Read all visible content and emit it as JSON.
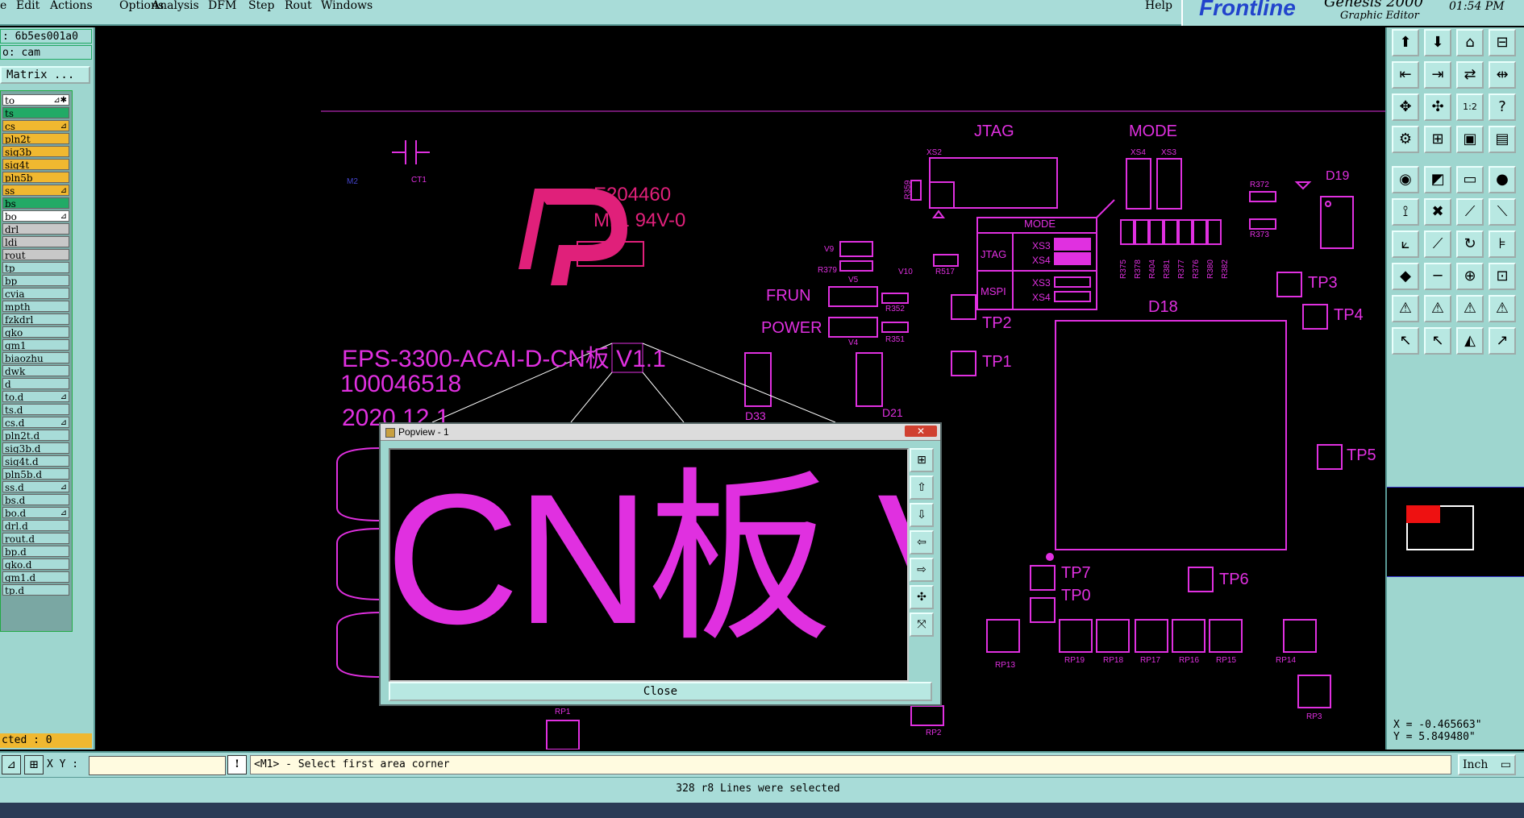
{
  "menu": [
    "Edit",
    "Actions",
    "Options",
    "Analysis",
    "DFM",
    "Step",
    "Rout",
    "Windows"
  ],
  "menu_first_partial": "e",
  "help": "Help",
  "brand": {
    "logo": "Frontline",
    "product": "Genesis 2000",
    "subtitle": "Graphic Editor",
    "time": "01:54 PM"
  },
  "left": {
    "job_field": ": 6b5es001a0",
    "step_field": "o: cam",
    "matrix_button": "Matrix ...",
    "layers": [
      {
        "name": "to",
        "color": "#ffffff",
        "mark": "⊿✱"
      },
      {
        "name": "ts",
        "color": "#22aa66",
        "mark": ""
      },
      {
        "name": "cs",
        "color": "#f0b830",
        "mark": "⊿"
      },
      {
        "name": "pln2t",
        "color": "#f0b830",
        "mark": ""
      },
      {
        "name": "sig3b",
        "color": "#f0b830",
        "mark": ""
      },
      {
        "name": "sig4t",
        "color": "#f0b830",
        "mark": ""
      },
      {
        "name": "pln5b",
        "color": "#f0b830",
        "mark": ""
      },
      {
        "name": "ss",
        "color": "#f0b830",
        "mark": "⊿"
      },
      {
        "name": "bs",
        "color": "#22aa66",
        "mark": ""
      },
      {
        "name": "bo",
        "color": "#ffffff",
        "mark": "⊿"
      },
      {
        "name": "drl",
        "color": "#c8c8c8",
        "mark": ""
      },
      {
        "name": "ldi",
        "color": "#c8c8c8",
        "mark": ""
      },
      {
        "name": "rout",
        "color": "#c8c8c8",
        "mark": ""
      },
      {
        "name": "tp",
        "color": "#a8dcd8",
        "mark": ""
      },
      {
        "name": "bp",
        "color": "#a8dcd8",
        "mark": ""
      },
      {
        "name": "cvia",
        "color": "#a8dcd8",
        "mark": ""
      },
      {
        "name": "mpth",
        "color": "#a8dcd8",
        "mark": ""
      },
      {
        "name": "fzkdrl",
        "color": "#a8dcd8",
        "mark": ""
      },
      {
        "name": "gko",
        "color": "#a8dcd8",
        "mark": ""
      },
      {
        "name": "gm1",
        "color": "#a8dcd8",
        "mark": ""
      },
      {
        "name": "biaozhu",
        "color": "#a8dcd8",
        "mark": ""
      },
      {
        "name": "dwk",
        "color": "#a8dcd8",
        "mark": ""
      },
      {
        "name": "d",
        "color": "#a8dcd8",
        "mark": ""
      },
      {
        "name": "to.d",
        "color": "#a8dcd8",
        "mark": "⊿"
      },
      {
        "name": "ts.d",
        "color": "#a8dcd8",
        "mark": ""
      },
      {
        "name": "cs.d",
        "color": "#a8dcd8",
        "mark": "⊿"
      },
      {
        "name": "pln2t.d",
        "color": "#a8dcd8",
        "mark": ""
      },
      {
        "name": "sig3b.d",
        "color": "#a8dcd8",
        "mark": ""
      },
      {
        "name": "sig4t.d",
        "color": "#a8dcd8",
        "mark": ""
      },
      {
        "name": "pln5b.d",
        "color": "#a8dcd8",
        "mark": ""
      },
      {
        "name": "ss.d",
        "color": "#a8dcd8",
        "mark": "⊿"
      },
      {
        "name": "bs.d",
        "color": "#a8dcd8",
        "mark": ""
      },
      {
        "name": "bo.d",
        "color": "#a8dcd8",
        "mark": "⊿"
      },
      {
        "name": "drl.d",
        "color": "#a8dcd8",
        "mark": ""
      },
      {
        "name": "rout.d",
        "color": "#a8dcd8",
        "mark": ""
      },
      {
        "name": "bp.d",
        "color": "#a8dcd8",
        "mark": ""
      },
      {
        "name": "gko.d",
        "color": "#a8dcd8",
        "mark": ""
      },
      {
        "name": "gm1.d",
        "color": "#a8dcd8",
        "mark": ""
      },
      {
        "name": "tp.d",
        "color": "#a8dcd8",
        "mark": ""
      }
    ],
    "selected": "cted : 0"
  },
  "canvas": {
    "labels": {
      "jtag": "JTAG",
      "mode": "MODE",
      "xs2": "XS2",
      "xs4": "XS4",
      "xs3": "XS3",
      "mode_small": "MODE",
      "jtag_small": "JTAG",
      "mspi": "MSPI",
      "xs3a": "XS3",
      "xs4a": "XS4",
      "xs3b": "XS3",
      "xs4b": "XS4",
      "ul": "E204460",
      "ul2": "M11 94V-0",
      "frun": "FRUN",
      "power": "POWER",
      "d18": "D18",
      "d19": "D19",
      "d21": "D21",
      "d33": "D33",
      "tp0": "TP0",
      "tp1": "TP1",
      "tp2": "TP2",
      "tp3": "TP3",
      "tp4": "TP4",
      "tp5": "TP5",
      "tp6": "TP6",
      "tp7": "TP7",
      "title1": "EPS-3300-ACAI-D-CN板 V1.1",
      "title2": "100046518",
      "title3": "2020.12.1",
      "ct1": "CT1",
      "m2": "M2",
      "v9": "V9",
      "v10": "V10",
      "v5": "V5",
      "v4": "V4",
      "r379": "R379",
      "r517": "R517",
      "r352": "R352",
      "r351": "R351",
      "r359": "R359",
      "r372": "R372",
      "r373": "R373",
      "rp1": "RP1",
      "rp2": "RP2",
      "rp3": "RP3",
      "rp13": "RP13",
      "rp19": "RP19",
      "rp18": "RP18",
      "rp17": "RP17",
      "rp16": "RP16",
      "rp15": "RP15",
      "rp14": "RP14",
      "rvert": [
        "R375",
        "R378",
        "R404",
        "R381",
        "R377",
        "R376",
        "R380",
        "R382"
      ]
    }
  },
  "popup": {
    "title": "Popview - 1",
    "zoom_text": "CN板 V",
    "close": "Close"
  },
  "bottom": {
    "xy_label": "X Y :",
    "xy_value": "",
    "prompt": "<M1> - Select first area corner",
    "units": "Inch",
    "status": "328 r8 Lines were selected"
  },
  "coords": {
    "x": "X = -0.465663\"",
    "y": "Y = 5.849480\""
  }
}
